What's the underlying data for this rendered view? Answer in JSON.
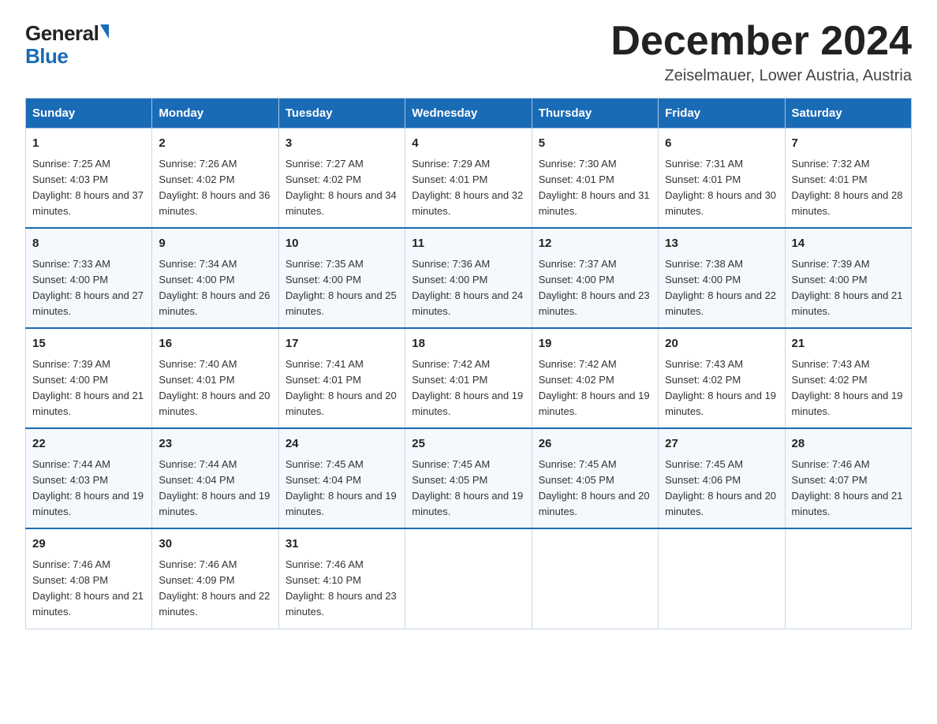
{
  "logo": {
    "general": "General",
    "blue": "Blue"
  },
  "title": "December 2024",
  "location": "Zeiselmauer, Lower Austria, Austria",
  "weekdays": [
    "Sunday",
    "Monday",
    "Tuesday",
    "Wednesday",
    "Thursday",
    "Friday",
    "Saturday"
  ],
  "weeks": [
    [
      {
        "day": "1",
        "sunrise": "7:25 AM",
        "sunset": "4:03 PM",
        "daylight": "8 hours and 37 minutes."
      },
      {
        "day": "2",
        "sunrise": "7:26 AM",
        "sunset": "4:02 PM",
        "daylight": "8 hours and 36 minutes."
      },
      {
        "day": "3",
        "sunrise": "7:27 AM",
        "sunset": "4:02 PM",
        "daylight": "8 hours and 34 minutes."
      },
      {
        "day": "4",
        "sunrise": "7:29 AM",
        "sunset": "4:01 PM",
        "daylight": "8 hours and 32 minutes."
      },
      {
        "day": "5",
        "sunrise": "7:30 AM",
        "sunset": "4:01 PM",
        "daylight": "8 hours and 31 minutes."
      },
      {
        "day": "6",
        "sunrise": "7:31 AM",
        "sunset": "4:01 PM",
        "daylight": "8 hours and 30 minutes."
      },
      {
        "day": "7",
        "sunrise": "7:32 AM",
        "sunset": "4:01 PM",
        "daylight": "8 hours and 28 minutes."
      }
    ],
    [
      {
        "day": "8",
        "sunrise": "7:33 AM",
        "sunset": "4:00 PM",
        "daylight": "8 hours and 27 minutes."
      },
      {
        "day": "9",
        "sunrise": "7:34 AM",
        "sunset": "4:00 PM",
        "daylight": "8 hours and 26 minutes."
      },
      {
        "day": "10",
        "sunrise": "7:35 AM",
        "sunset": "4:00 PM",
        "daylight": "8 hours and 25 minutes."
      },
      {
        "day": "11",
        "sunrise": "7:36 AM",
        "sunset": "4:00 PM",
        "daylight": "8 hours and 24 minutes."
      },
      {
        "day": "12",
        "sunrise": "7:37 AM",
        "sunset": "4:00 PM",
        "daylight": "8 hours and 23 minutes."
      },
      {
        "day": "13",
        "sunrise": "7:38 AM",
        "sunset": "4:00 PM",
        "daylight": "8 hours and 22 minutes."
      },
      {
        "day": "14",
        "sunrise": "7:39 AM",
        "sunset": "4:00 PM",
        "daylight": "8 hours and 21 minutes."
      }
    ],
    [
      {
        "day": "15",
        "sunrise": "7:39 AM",
        "sunset": "4:00 PM",
        "daylight": "8 hours and 21 minutes."
      },
      {
        "day": "16",
        "sunrise": "7:40 AM",
        "sunset": "4:01 PM",
        "daylight": "8 hours and 20 minutes."
      },
      {
        "day": "17",
        "sunrise": "7:41 AM",
        "sunset": "4:01 PM",
        "daylight": "8 hours and 20 minutes."
      },
      {
        "day": "18",
        "sunrise": "7:42 AM",
        "sunset": "4:01 PM",
        "daylight": "8 hours and 19 minutes."
      },
      {
        "day": "19",
        "sunrise": "7:42 AM",
        "sunset": "4:02 PM",
        "daylight": "8 hours and 19 minutes."
      },
      {
        "day": "20",
        "sunrise": "7:43 AM",
        "sunset": "4:02 PM",
        "daylight": "8 hours and 19 minutes."
      },
      {
        "day": "21",
        "sunrise": "7:43 AM",
        "sunset": "4:02 PM",
        "daylight": "8 hours and 19 minutes."
      }
    ],
    [
      {
        "day": "22",
        "sunrise": "7:44 AM",
        "sunset": "4:03 PM",
        "daylight": "8 hours and 19 minutes."
      },
      {
        "day": "23",
        "sunrise": "7:44 AM",
        "sunset": "4:04 PM",
        "daylight": "8 hours and 19 minutes."
      },
      {
        "day": "24",
        "sunrise": "7:45 AM",
        "sunset": "4:04 PM",
        "daylight": "8 hours and 19 minutes."
      },
      {
        "day": "25",
        "sunrise": "7:45 AM",
        "sunset": "4:05 PM",
        "daylight": "8 hours and 19 minutes."
      },
      {
        "day": "26",
        "sunrise": "7:45 AM",
        "sunset": "4:05 PM",
        "daylight": "8 hours and 20 minutes."
      },
      {
        "day": "27",
        "sunrise": "7:45 AM",
        "sunset": "4:06 PM",
        "daylight": "8 hours and 20 minutes."
      },
      {
        "day": "28",
        "sunrise": "7:46 AM",
        "sunset": "4:07 PM",
        "daylight": "8 hours and 21 minutes."
      }
    ],
    [
      {
        "day": "29",
        "sunrise": "7:46 AM",
        "sunset": "4:08 PM",
        "daylight": "8 hours and 21 minutes."
      },
      {
        "day": "30",
        "sunrise": "7:46 AM",
        "sunset": "4:09 PM",
        "daylight": "8 hours and 22 minutes."
      },
      {
        "day": "31",
        "sunrise": "7:46 AM",
        "sunset": "4:10 PM",
        "daylight": "8 hours and 23 minutes."
      },
      null,
      null,
      null,
      null
    ]
  ]
}
